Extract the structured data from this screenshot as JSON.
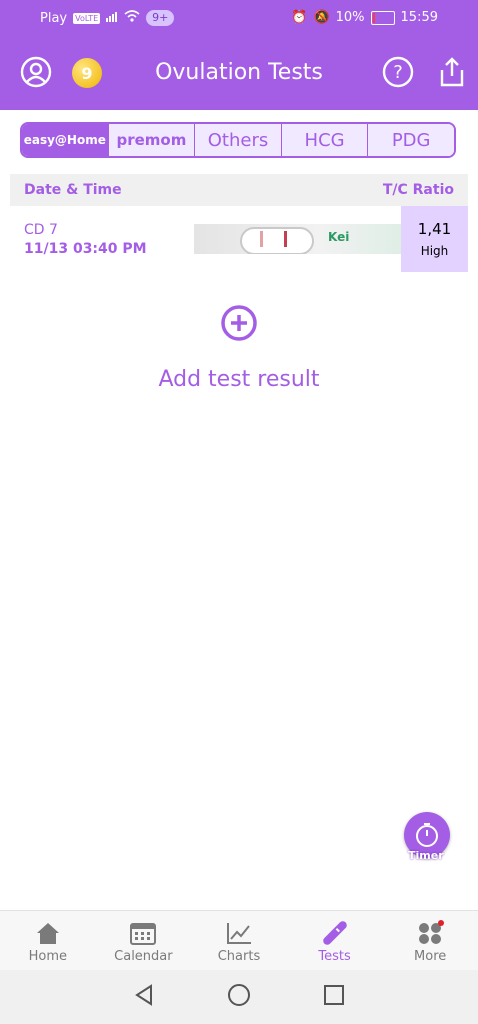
{
  "status_bar": {
    "carrier": "Play",
    "volte": "VoLTE",
    "notifications": "9+",
    "battery": "10%",
    "time": "15:59"
  },
  "header": {
    "title": "Ovulation Tests",
    "badge_count": "9"
  },
  "brand_tabs": [
    {
      "label": "easy@Home",
      "active": true
    },
    {
      "label": "premom",
      "active": false
    },
    {
      "label": "Others",
      "active": false
    },
    {
      "label": "HCG",
      "active": false
    },
    {
      "label": "PDG",
      "active": false
    }
  ],
  "table": {
    "col_date": "Date & Time",
    "col_ratio": "T/C Ratio",
    "rows": [
      {
        "cycle_day": "CD 7",
        "datetime": "11/13  03:40 PM",
        "strip_brand": "Kei",
        "ratio": "1,41",
        "level": "High"
      }
    ]
  },
  "add_result": {
    "label": "Add test result"
  },
  "timer": {
    "label": "Timer"
  },
  "tabs": [
    {
      "label": "Home",
      "icon": "home-icon"
    },
    {
      "label": "Calendar",
      "icon": "calendar-icon"
    },
    {
      "label": "Charts",
      "icon": "chart-icon"
    },
    {
      "label": "Tests",
      "icon": "test-strip-icon",
      "active": true
    },
    {
      "label": "More",
      "icon": "more-icon"
    }
  ],
  "colors": {
    "accent": "#a45ee5",
    "ratio_bg": "#e3d1ff"
  }
}
